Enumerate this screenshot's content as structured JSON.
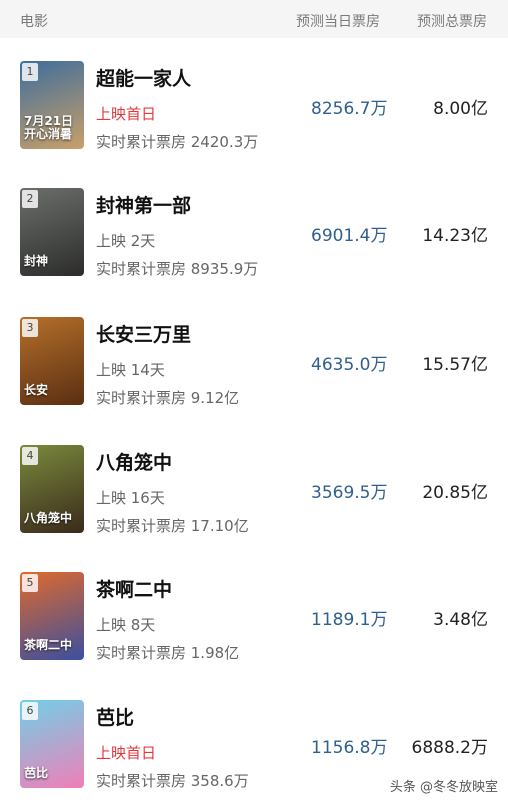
{
  "header": {
    "movie": "电影",
    "today_forecast": "预测当日票房",
    "total_forecast": "预测总票房"
  },
  "movies": [
    {
      "rank": "1",
      "title": "超能一家人",
      "release": "上映首日",
      "release_highlight": true,
      "cumulative": "实时累计票房 2420.3万",
      "today": "8256.7万",
      "total": "8.00亿",
      "poster_text": "7月21日\n开心消暑",
      "poster_colors": [
        "#3e6d9c",
        "#c9a06a"
      ]
    },
    {
      "rank": "2",
      "title": "封神第一部",
      "release": "上映 2天",
      "release_highlight": false,
      "cumulative": "实时累计票房 8935.9万",
      "today": "6901.4万",
      "total": "14.23亿",
      "poster_text": "封神",
      "poster_colors": [
        "#6b6f6a",
        "#2c2d2b"
      ]
    },
    {
      "rank": "3",
      "title": "长安三万里",
      "release": "上映 14天",
      "release_highlight": false,
      "cumulative": "实时累计票房 9.12亿",
      "today": "4635.0万",
      "total": "15.57亿",
      "poster_text": "长安",
      "poster_colors": [
        "#b5702a",
        "#5a2e12"
      ]
    },
    {
      "rank": "4",
      "title": "八角笼中",
      "release": "上映 16天",
      "release_highlight": false,
      "cumulative": "实时累计票房 17.10亿",
      "today": "3569.5万",
      "total": "20.85亿",
      "poster_text": "八角笼中",
      "poster_colors": [
        "#7a8a3c",
        "#3a2a1c"
      ]
    },
    {
      "rank": "5",
      "title": "茶啊二中",
      "release": "上映 8天",
      "release_highlight": false,
      "cumulative": "实时累计票房 1.98亿",
      "today": "1189.1万",
      "total": "3.48亿",
      "poster_text": "茶啊二中",
      "poster_colors": [
        "#e06a2a",
        "#3a4fa0"
      ]
    },
    {
      "rank": "6",
      "title": "芭比",
      "release": "上映首日",
      "release_highlight": true,
      "cumulative": "实时累计票房 358.6万",
      "today": "1156.8万",
      "total": "6888.2万",
      "poster_text": "芭比",
      "poster_colors": [
        "#6fd0e8",
        "#f07fb7"
      ]
    }
  ],
  "watermark": "头条 @冬冬放映室"
}
